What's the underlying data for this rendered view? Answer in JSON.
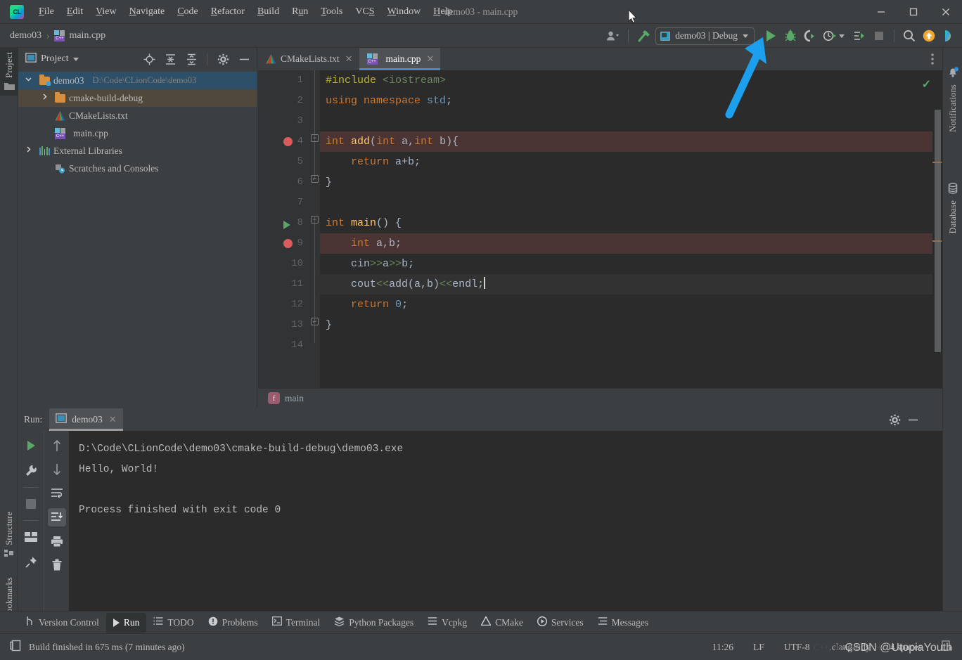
{
  "window": {
    "title": "demo03 - main.cpp",
    "minimize_label": "—",
    "maximize_label": "☐",
    "close_label": "✕"
  },
  "menubar": {
    "items": [
      {
        "label": "File",
        "mnemonic": "F"
      },
      {
        "label": "Edit",
        "mnemonic": "E"
      },
      {
        "label": "View",
        "mnemonic": "V"
      },
      {
        "label": "Navigate",
        "mnemonic": "N"
      },
      {
        "label": "Code",
        "mnemonic": "C"
      },
      {
        "label": "Refactor",
        "mnemonic": "R"
      },
      {
        "label": "Build",
        "mnemonic": "B"
      },
      {
        "label": "Run",
        "mnemonic": "u"
      },
      {
        "label": "Tools",
        "mnemonic": "T"
      },
      {
        "label": "VCS",
        "mnemonic": "S"
      },
      {
        "label": "Window",
        "mnemonic": "W"
      },
      {
        "label": "Help",
        "mnemonic": "H"
      }
    ]
  },
  "navbar": {
    "breadcrumb_project": "demo03",
    "breadcrumb_sep": "›",
    "breadcrumb_file": "main.cpp",
    "file_icon_label": "C++",
    "run_config": {
      "name": "demo03 | Debug",
      "dropdown_icon": "chevron-down-icon"
    },
    "buttons": [
      {
        "name": "user-account-icon",
        "label": ""
      },
      {
        "name": "build-hammer-icon",
        "label": ""
      },
      {
        "name": "run-button",
        "label": ""
      },
      {
        "name": "debug-button",
        "label": ""
      },
      {
        "name": "run-with-coverage-button",
        "label": ""
      },
      {
        "name": "profile-button",
        "label": ""
      },
      {
        "name": "attach-to-process-button",
        "label": ""
      },
      {
        "name": "stop-button",
        "label": ""
      },
      {
        "name": "search-everywhere-button",
        "label": ""
      },
      {
        "name": "updates-button",
        "label": ""
      },
      {
        "name": "ai-assistant-button",
        "label": ""
      }
    ]
  },
  "left_stripe": {
    "project_label": "Project",
    "structure_label": "Structure",
    "bookmarks_label": "Bookmarks"
  },
  "right_stripe": {
    "notifications_label": "Notifications",
    "database_label": "Database"
  },
  "project_panel": {
    "title": "Project",
    "header_buttons": [
      "locate-icon",
      "expand-all-icon",
      "collapse-all-icon",
      "settings-gear-icon",
      "hide-icon"
    ],
    "tree": [
      {
        "label": "demo03",
        "path": "D:\\Code\\CLionCode\\demo03",
        "icon": "project-folder-icon",
        "depth": 0,
        "expanded": true,
        "state": "selected"
      },
      {
        "label": "cmake-build-debug",
        "path": "",
        "icon": "folder-icon",
        "depth": 1,
        "expanded": false,
        "state": "highlighted"
      },
      {
        "label": "CMakeLists.txt",
        "path": "",
        "icon": "cmake-icon",
        "depth": 1,
        "expanded": null,
        "state": "normal"
      },
      {
        "label": "main.cpp",
        "path": "",
        "icon": "cpp-file-icon",
        "depth": 1,
        "expanded": null,
        "state": "normal"
      },
      {
        "label": "External Libraries",
        "path": "",
        "icon": "libraries-icon",
        "depth": 0,
        "expanded": false,
        "state": "normal"
      },
      {
        "label": "Scratches and Consoles",
        "path": "",
        "icon": "scratches-icon",
        "depth": 0,
        "expanded": null,
        "state": "normal"
      }
    ]
  },
  "editor": {
    "tabs": [
      {
        "label": "CMakeLists.txt",
        "icon": "cmake-icon",
        "active": false,
        "close": "✕"
      },
      {
        "label": "main.cpp",
        "icon": "cpp-file-icon",
        "active": true,
        "close": "✕"
      }
    ],
    "inspection_status": "✓",
    "options_icon": "kebab-menu-icon",
    "breadcrumb": {
      "badge": "f",
      "text": "main"
    },
    "lines": [
      {
        "n": 1,
        "text": "#include <iostream>"
      },
      {
        "n": 2,
        "text": "using namespace std;"
      },
      {
        "n": 3,
        "text": ""
      },
      {
        "n": 4,
        "text": "int add(int a,int b){",
        "breakpoint": true,
        "fold": "open",
        "highlight": "breakpoint"
      },
      {
        "n": 5,
        "text": "    return a+b;"
      },
      {
        "n": 6,
        "text": "}",
        "fold": "close"
      },
      {
        "n": 7,
        "text": ""
      },
      {
        "n": 8,
        "text": "int main() {",
        "runmark": true,
        "fold": "open"
      },
      {
        "n": 9,
        "text": "    int a,b;",
        "breakpoint": true,
        "highlight": "breakpoint"
      },
      {
        "n": 10,
        "text": "    cin>>a>>b;"
      },
      {
        "n": 11,
        "text": "    cout<<add(a,b)<<endl;",
        "highlight": "caret"
      },
      {
        "n": 12,
        "text": "    return 0;"
      },
      {
        "n": 13,
        "text": "}",
        "fold": "close"
      },
      {
        "n": 14,
        "text": ""
      }
    ]
  },
  "run_panel": {
    "label": "Run:",
    "tab_name": "demo03",
    "tab_close": "✕",
    "settings_icon": "settings-gear-icon",
    "hide_icon": "hide-icon",
    "left_tools": [
      "rerun-button",
      "settings-wrench-button",
      "stop-button",
      "layout-button",
      "pin-button"
    ],
    "right_tools": [
      "scroll-up-button",
      "scroll-down-button",
      "soft-wrap-button",
      "scroll-to-end-button",
      "print-button",
      "clear-all-button"
    ],
    "console_lines": [
      "D:\\Code\\CLionCode\\demo03\\cmake-build-debug\\demo03.exe",
      "Hello, World!",
      "",
      "Process finished with exit code 0"
    ]
  },
  "toolwindow_bar": {
    "items": [
      {
        "label": "Version Control",
        "icon": "branch-icon",
        "active": false
      },
      {
        "label": "Run",
        "icon": "play-icon",
        "active": true
      },
      {
        "label": "TODO",
        "icon": "list-icon",
        "active": false
      },
      {
        "label": "Problems",
        "icon": "warning-icon",
        "active": false
      },
      {
        "label": "Terminal",
        "icon": "terminal-icon",
        "active": false
      },
      {
        "label": "Python Packages",
        "icon": "packages-icon",
        "active": false
      },
      {
        "label": "Vcpkg",
        "icon": "list-icon",
        "active": false
      },
      {
        "label": "CMake",
        "icon": "cmake-icon",
        "active": false
      },
      {
        "label": "Services",
        "icon": "services-icon",
        "active": false
      },
      {
        "label": "Messages",
        "icon": "messages-icon",
        "active": false
      }
    ]
  },
  "statusbar": {
    "build_status": "Build finished in 675 ms (7 minutes ago)",
    "build_icon": "build-icon",
    "cells": [
      "11:26",
      "LF",
      "UTF-8",
      ".clang-tidy",
      "4 spaces"
    ],
    "ghost_text": "C++: demo03 | Debug",
    "watermark": "CSDN @UtopiaYouth"
  },
  "annotation": {
    "arrow_color": "#1ca0ee",
    "points_to": "debug-button"
  },
  "colors": {
    "bg": "#3c3f41",
    "editor_bg": "#2b2b2b",
    "gutter_bg": "#313335",
    "accent_blue": "#4a88c7",
    "green_run": "#59a869",
    "breakpoint_red": "#db5c5c",
    "selection_blue": "#2d4f67"
  }
}
